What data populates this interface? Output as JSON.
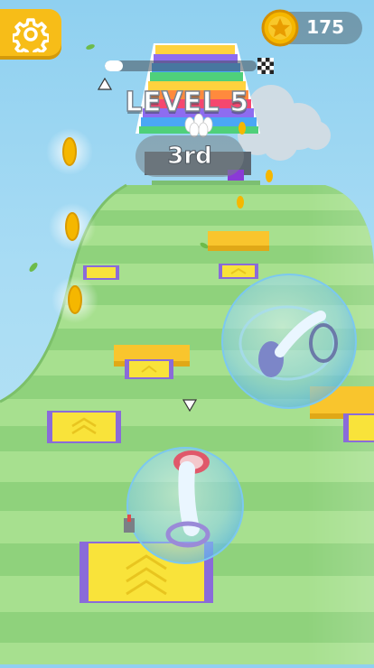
{
  "hud": {
    "settings_icon": "gear-icon",
    "coins": "175",
    "coin_icon": "star-coin-icon",
    "level_progress": 0.12,
    "finish_icon": "checkered-flag-icon"
  },
  "race": {
    "level_label": "LEVEL 5",
    "rank_label": "3rd"
  },
  "colors": {
    "hud_yellow": "#f7bd18",
    "coin_gold": "#f5b700",
    "track_green": "#8dd17a",
    "pad_yellow": "#f9e33a",
    "pad_purple": "#8a6bd9",
    "bubble_blue": "#7cc8f0"
  }
}
